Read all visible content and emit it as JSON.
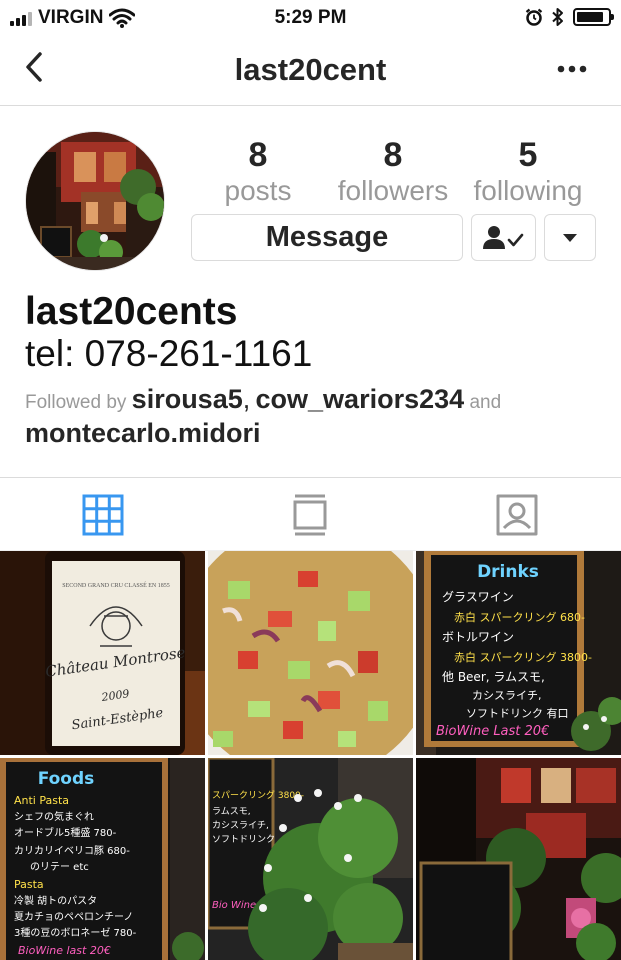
{
  "status_bar": {
    "carrier": "VIRGIN",
    "time": "5:29 PM"
  },
  "nav": {
    "title": "last20cent",
    "back_icon": "chevron-left-icon",
    "more_icon": "more-horizontal-icon"
  },
  "profile": {
    "stats": [
      {
        "count": "8",
        "label": "posts"
      },
      {
        "count": "8",
        "label": "followers"
      },
      {
        "count": "5",
        "label": "following"
      }
    ],
    "message_label": "Message",
    "name": "last20cents",
    "bio": "tel: 078-261-1161",
    "followed_by": {
      "prefix": "Followed by",
      "user1": "sirousa5",
      "sep": ",",
      "user2": "cow_wariors234",
      "and": "and",
      "user3": "montecarlo.midori"
    }
  },
  "tabs": [
    {
      "icon": "grid-icon",
      "active": true
    },
    {
      "icon": "feed-icon",
      "active": false
    },
    {
      "icon": "tagged-icon",
      "active": false
    }
  ],
  "posts": {
    "wine_label": {
      "line1": "Château Montrose",
      "line2": "2009",
      "line3": "Saint-Estèphe"
    },
    "drinks_board": {
      "title": "Drinks",
      "lines": [
        "グラスワイン",
        "赤白 スパークリング 680-",
        "ボトルワイン",
        "赤白 スパークリング 3800-",
        "他 Beer, ラムスモ,",
        "カシスライチ,",
        "ソフトドリンク 有口"
      ],
      "footer": "BioWine Last 20€"
    },
    "foods_board": {
      "title": "Foods",
      "lines": [
        "Anti Pasta",
        "シェフの気まぐれ",
        "オードブル5種盛 780-",
        "カリカリイベリコ豚 680-",
        "のリテー etc",
        "Pasta",
        "冷製 胡トのパスタ",
        "夏カチョのペペロンチーノ",
        "3種の豆のボロネーゼ 780-"
      ],
      "footer": "BioWine last 20€"
    },
    "plants_board": {
      "lines": [
        "スパークリング 3800-",
        "ラムスモ,",
        "カシスライチ,",
        "ソフトドリンク"
      ],
      "footer": "Bio Wine"
    }
  },
  "colors": {
    "active_tab": "#3897f0",
    "inactive_tab": "#999999",
    "chalk_pink": "#ff5fbf",
    "chalk_blue": "#6fd3ff",
    "chalk_yellow": "#ffe14a",
    "chalk_green": "#9be86a"
  }
}
